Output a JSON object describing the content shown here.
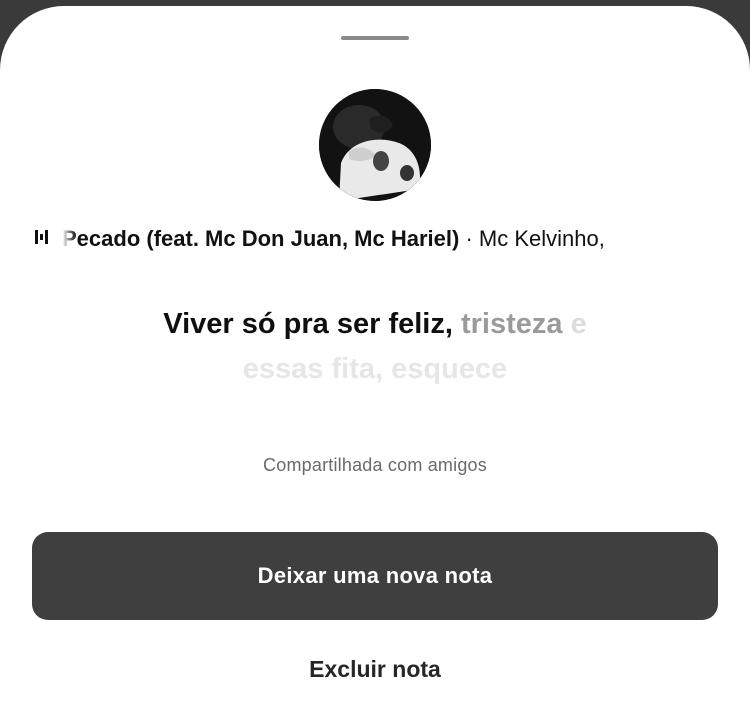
{
  "sheet": {
    "track": {
      "title": "Pecado (feat. Mc Don Juan, Mc Hariel)",
      "separator": "·",
      "artist": "Mc Kelvinho,"
    },
    "lyrics": {
      "line1_active": "Viver só pra ser feliz,",
      "line1_next": "tristeza",
      "line1_fade": "e",
      "line2": "essas fita, esquece"
    },
    "audience": "Compartilhada com amigos",
    "primary_button": "Deixar uma nova nota",
    "secondary_button": "Excluir nota"
  },
  "icons": {
    "music": "music-bars-icon"
  },
  "colors": {
    "sheet_bg": "#ffffff",
    "primary_button_bg": "#3f3f3f",
    "primary_button_text": "#ffffff"
  }
}
